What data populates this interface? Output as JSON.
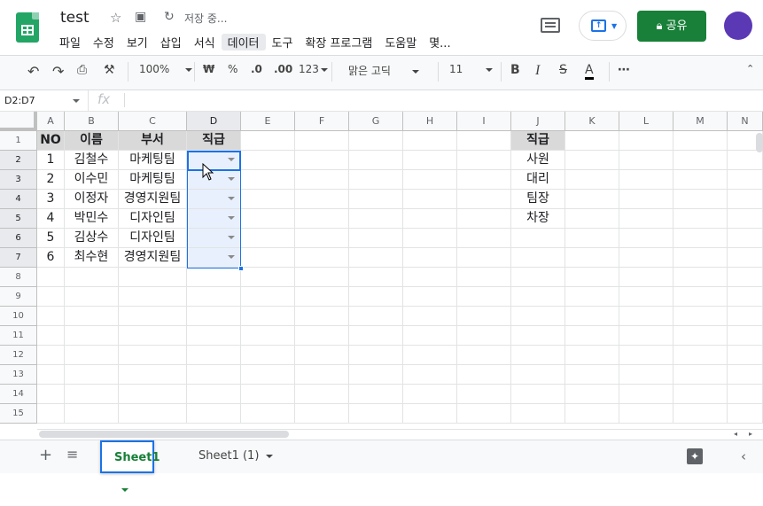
{
  "header": {
    "title": "test",
    "saving_status": "저장 중...",
    "share_label": "공유"
  },
  "menu": [
    "파일",
    "수정",
    "보기",
    "삽입",
    "서식",
    "데이터",
    "도구",
    "확장 프로그램",
    "도움말",
    "몇..."
  ],
  "toolbar": {
    "zoom": "100%",
    "currency": "₩",
    "percent": "%",
    "dec_decrease": ".0",
    "dec_increase": ".00",
    "format_more": "123",
    "font_family": "맑은 고딕",
    "font_size": "11",
    "bold": "B",
    "italic": "I",
    "strike": "S",
    "text_color": "A",
    "more": "⋯"
  },
  "formula_bar": {
    "name_box": "D2:D7",
    "fx": "fx"
  },
  "columns": [
    "A",
    "B",
    "C",
    "D",
    "E",
    "F",
    "G",
    "H",
    "I",
    "J",
    "K",
    "L",
    "M",
    "N"
  ],
  "rows": [
    "1",
    "2",
    "3",
    "4",
    "5",
    "6",
    "7",
    "8",
    "9",
    "10",
    "11",
    "12",
    "13",
    "14",
    "15"
  ],
  "table": {
    "headers": [
      "NO",
      "이름",
      "부서",
      "직급"
    ],
    "rows": [
      [
        "1",
        "김철수",
        "마케팅팀",
        ""
      ],
      [
        "2",
        "이수민",
        "마케팅팀",
        ""
      ],
      [
        "3",
        "이정자",
        "경영지원팀",
        ""
      ],
      [
        "4",
        "박민수",
        "디자인팀",
        ""
      ],
      [
        "5",
        "김상수",
        "디자인팀",
        ""
      ],
      [
        "6",
        "최수현",
        "경영지원팀",
        ""
      ]
    ]
  },
  "rank_list": {
    "header": "직급",
    "items": [
      "사원",
      "대리",
      "팀장",
      "차장"
    ]
  },
  "sheets": [
    {
      "label": "Sheet1"
    },
    {
      "label": "Sheet1 (1)"
    }
  ],
  "colors": {
    "accent": "#1a73e8",
    "brand_green": "#188038",
    "header_fill": "#d9d9d9",
    "dropdown_fill": "#e8f0fe"
  }
}
